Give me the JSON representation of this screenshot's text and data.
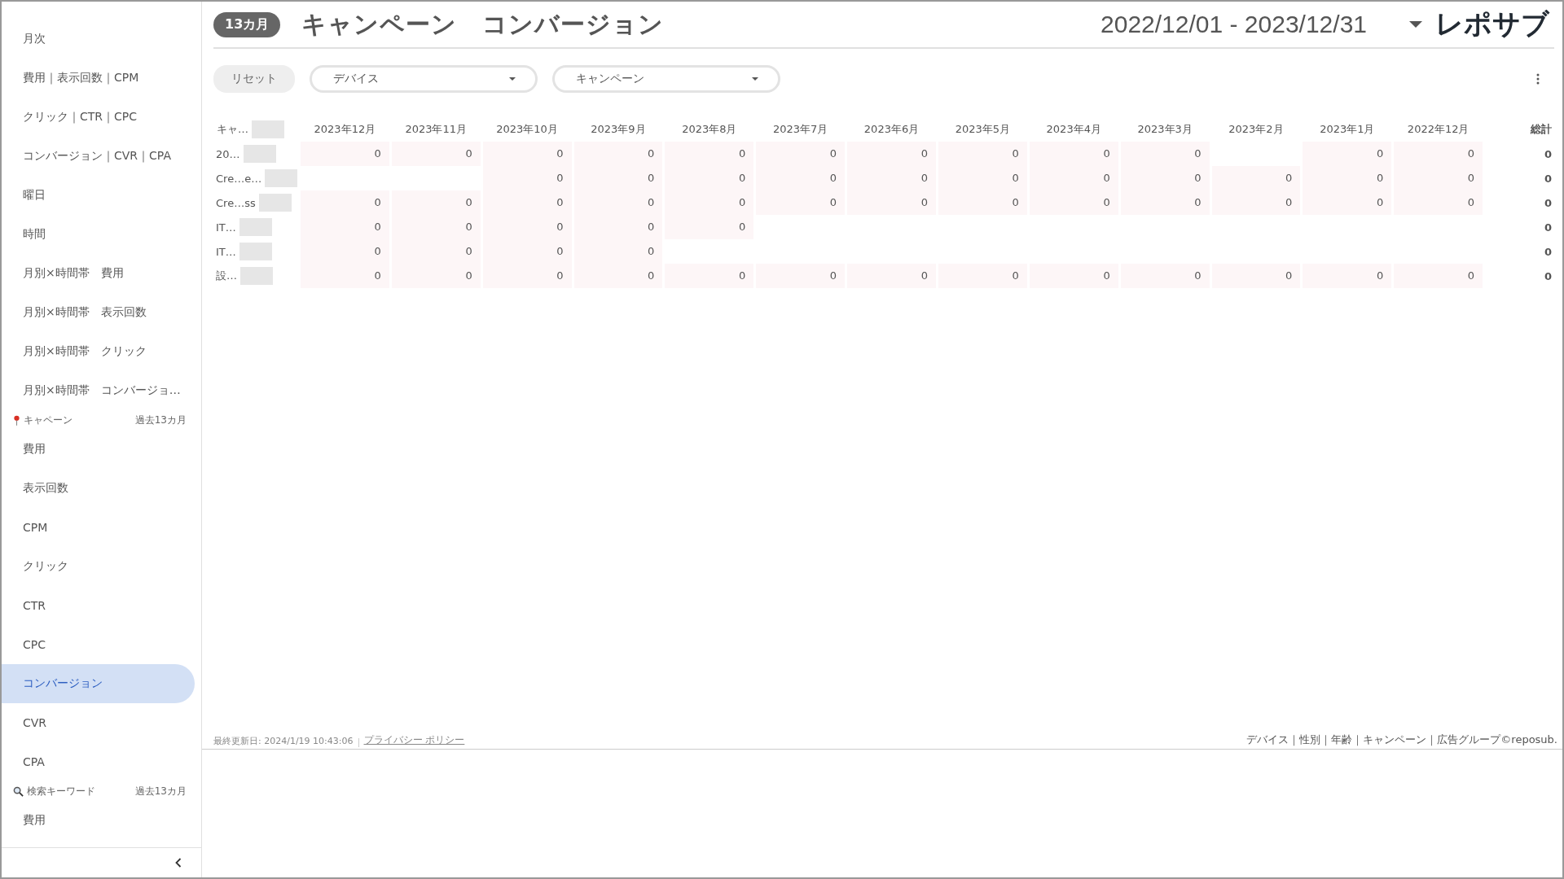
{
  "sidebar": {
    "items": [
      {
        "kind": "item",
        "label": "月次",
        "selected": false
      },
      {
        "kind": "item",
        "label": "費用｜表示回数｜CPM",
        "selected": false
      },
      {
        "kind": "item",
        "label": "クリック｜CTR｜CPC",
        "selected": false
      },
      {
        "kind": "item",
        "label": "コンバージョン｜CVR｜CPA",
        "selected": false
      },
      {
        "kind": "item",
        "label": "曜日",
        "selected": false
      },
      {
        "kind": "item",
        "label": "時間",
        "selected": false
      },
      {
        "kind": "item",
        "label": "月別×時間帯　費用",
        "selected": false
      },
      {
        "kind": "item",
        "label": "月別×時間帯　表示回数",
        "selected": false
      },
      {
        "kind": "item",
        "label": "月別×時間帯　クリック",
        "selected": false
      },
      {
        "kind": "item",
        "label": "月別×時間帯　コンバージョ…",
        "selected": false
      },
      {
        "kind": "section",
        "label": "キャペーン",
        "period": "過去13カ月"
      },
      {
        "kind": "item",
        "label": "費用",
        "selected": false
      },
      {
        "kind": "item",
        "label": "表示回数",
        "selected": false
      },
      {
        "kind": "item",
        "label": "CPM",
        "selected": false
      },
      {
        "kind": "item",
        "label": "クリック",
        "selected": false
      },
      {
        "kind": "item",
        "label": "CTR",
        "selected": false
      },
      {
        "kind": "item",
        "label": "CPC",
        "selected": false
      },
      {
        "kind": "item",
        "label": "コンバージョン",
        "selected": true
      },
      {
        "kind": "item",
        "label": "CVR",
        "selected": false
      },
      {
        "kind": "item",
        "label": "CPA",
        "selected": false
      },
      {
        "kind": "section",
        "label": "検索キーワード",
        "period": "過去13カ月"
      },
      {
        "kind": "item",
        "label": "費用",
        "selected": false
      }
    ]
  },
  "header": {
    "badge": "13カ月",
    "title": "キャンペーン　コンバージョン",
    "date_range": "2022/12/01 - 2023/12/31",
    "logo": "レポサブ"
  },
  "filters": {
    "reset": "リセット",
    "dropdowns": [
      "デバイス",
      "キャンペーン"
    ]
  },
  "table": {
    "columns": [
      "キャ…",
      "2023年12月",
      "2023年11月",
      "2023年10月",
      "2023年9月",
      "2023年8月",
      "2023年7月",
      "2023年6月",
      "2023年5月",
      "2023年4月",
      "2023年3月",
      "2023年2月",
      "2023年1月",
      "2022年12月",
      "総計"
    ],
    "rows": [
      {
        "cells": [
          "20…",
          "0",
          "0",
          "0",
          "0",
          "0",
          "0",
          "0",
          "0",
          "0",
          "0",
          null,
          "0",
          "0",
          "0"
        ]
      },
      {
        "cells": [
          "Cre…e…",
          null,
          null,
          "0",
          "0",
          "0",
          "0",
          "0",
          "0",
          "0",
          "0",
          "0",
          "0",
          "0",
          "0"
        ]
      },
      {
        "cells": [
          "Cre…ss",
          "0",
          "0",
          "0",
          "0",
          "0",
          "0",
          "0",
          "0",
          "0",
          "0",
          "0",
          "0",
          "0",
          "0"
        ]
      },
      {
        "cells": [
          "IT…",
          "0",
          "0",
          "0",
          "0",
          "0",
          null,
          null,
          null,
          null,
          null,
          null,
          null,
          null,
          "0"
        ]
      },
      {
        "cells": [
          "IT…",
          "0",
          "0",
          "0",
          "0",
          null,
          null,
          null,
          null,
          null,
          null,
          null,
          null,
          null,
          "0"
        ]
      },
      {
        "cells": [
          "設…",
          "0",
          "0",
          "0",
          "0",
          "0",
          "0",
          "0",
          "0",
          "0",
          "0",
          "0",
          "0",
          "0",
          "0"
        ]
      }
    ]
  },
  "footer": {
    "updated": "最終更新日: 2024/1/19 10:43:06",
    "privacy_link": "プライバシー ポリシー",
    "categories": "デバイス｜性別｜年齢｜キャンペーン｜広告グループ©reposub."
  }
}
